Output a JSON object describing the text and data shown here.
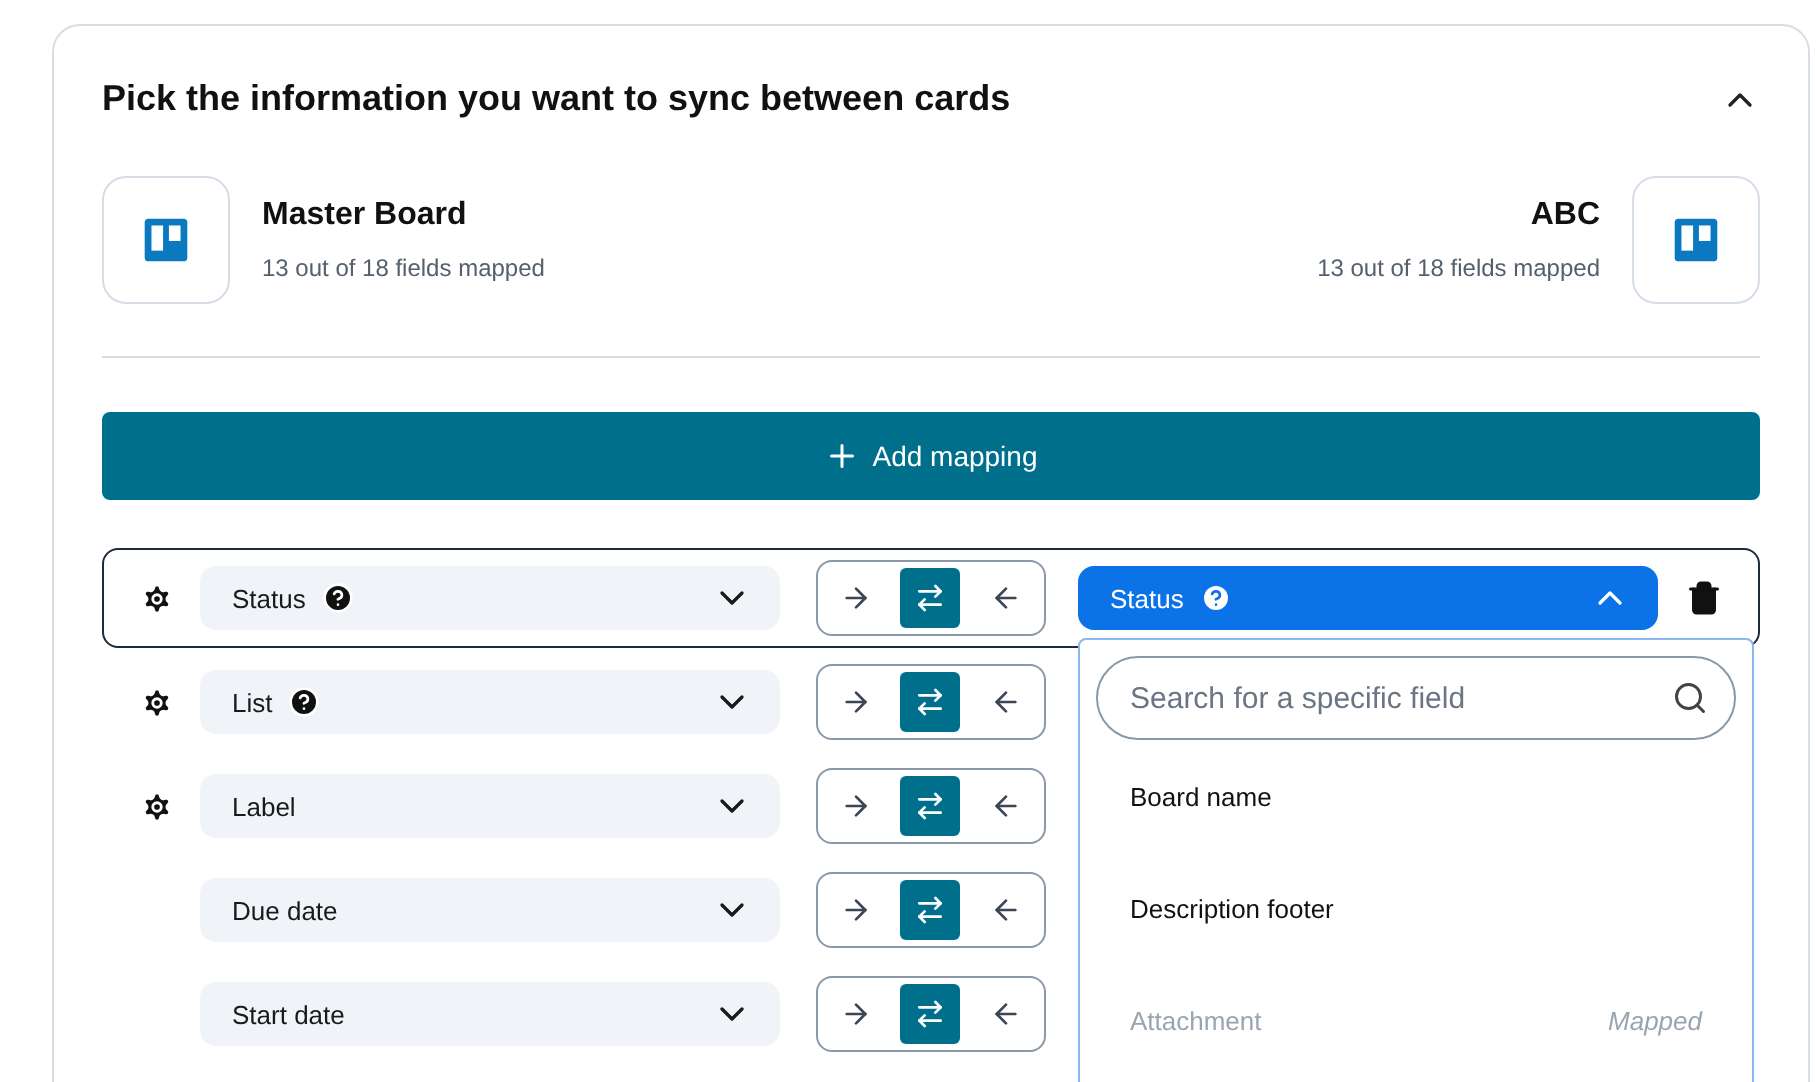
{
  "section": {
    "title": "Pick the information you want to sync between cards",
    "expanded": true
  },
  "boards": [
    {
      "name": "Master Board",
      "summary": "13 out of 18 fields mapped"
    },
    {
      "name": "ABC",
      "summary": "13 out of 18 fields mapped"
    }
  ],
  "add_button": {
    "label": "Add mapping"
  },
  "mappings": [
    {
      "field": "Status",
      "settings": true,
      "help": true,
      "active": true,
      "directions": [
        {
          "kind": "right",
          "selected": false
        },
        {
          "kind": "both",
          "selected": true
        },
        {
          "kind": "left",
          "selected": false
        }
      ],
      "target": {
        "field": "Status",
        "help": true,
        "open": true
      }
    },
    {
      "field": "List",
      "settings": true,
      "help": true,
      "active": false,
      "directions": [
        {
          "kind": "right",
          "selected": false
        },
        {
          "kind": "both",
          "selected": true
        },
        {
          "kind": "left",
          "selected": false
        }
      ]
    },
    {
      "field": "Label",
      "settings": true,
      "help": false,
      "active": false,
      "directions": [
        {
          "kind": "right",
          "selected": false
        },
        {
          "kind": "both",
          "selected": true
        },
        {
          "kind": "left",
          "selected": false
        }
      ]
    },
    {
      "field": "Due date",
      "settings": false,
      "help": false,
      "active": false,
      "directions": [
        {
          "kind": "right",
          "selected": false
        },
        {
          "kind": "both",
          "selected": true
        },
        {
          "kind": "left",
          "selected": false
        }
      ]
    },
    {
      "field": "Start date",
      "settings": false,
      "help": false,
      "active": false,
      "directions": [
        {
          "kind": "right",
          "selected": false
        },
        {
          "kind": "both",
          "selected": true
        },
        {
          "kind": "left",
          "selected": false
        }
      ]
    }
  ],
  "dropdown": {
    "search": {
      "placeholder": "Search for a specific field"
    },
    "options": [
      {
        "label": "Board name",
        "disabled": false
      },
      {
        "label": "Description footer",
        "disabled": false
      },
      {
        "label": "Attachment",
        "disabled": true,
        "note": "Mapped"
      }
    ]
  }
}
